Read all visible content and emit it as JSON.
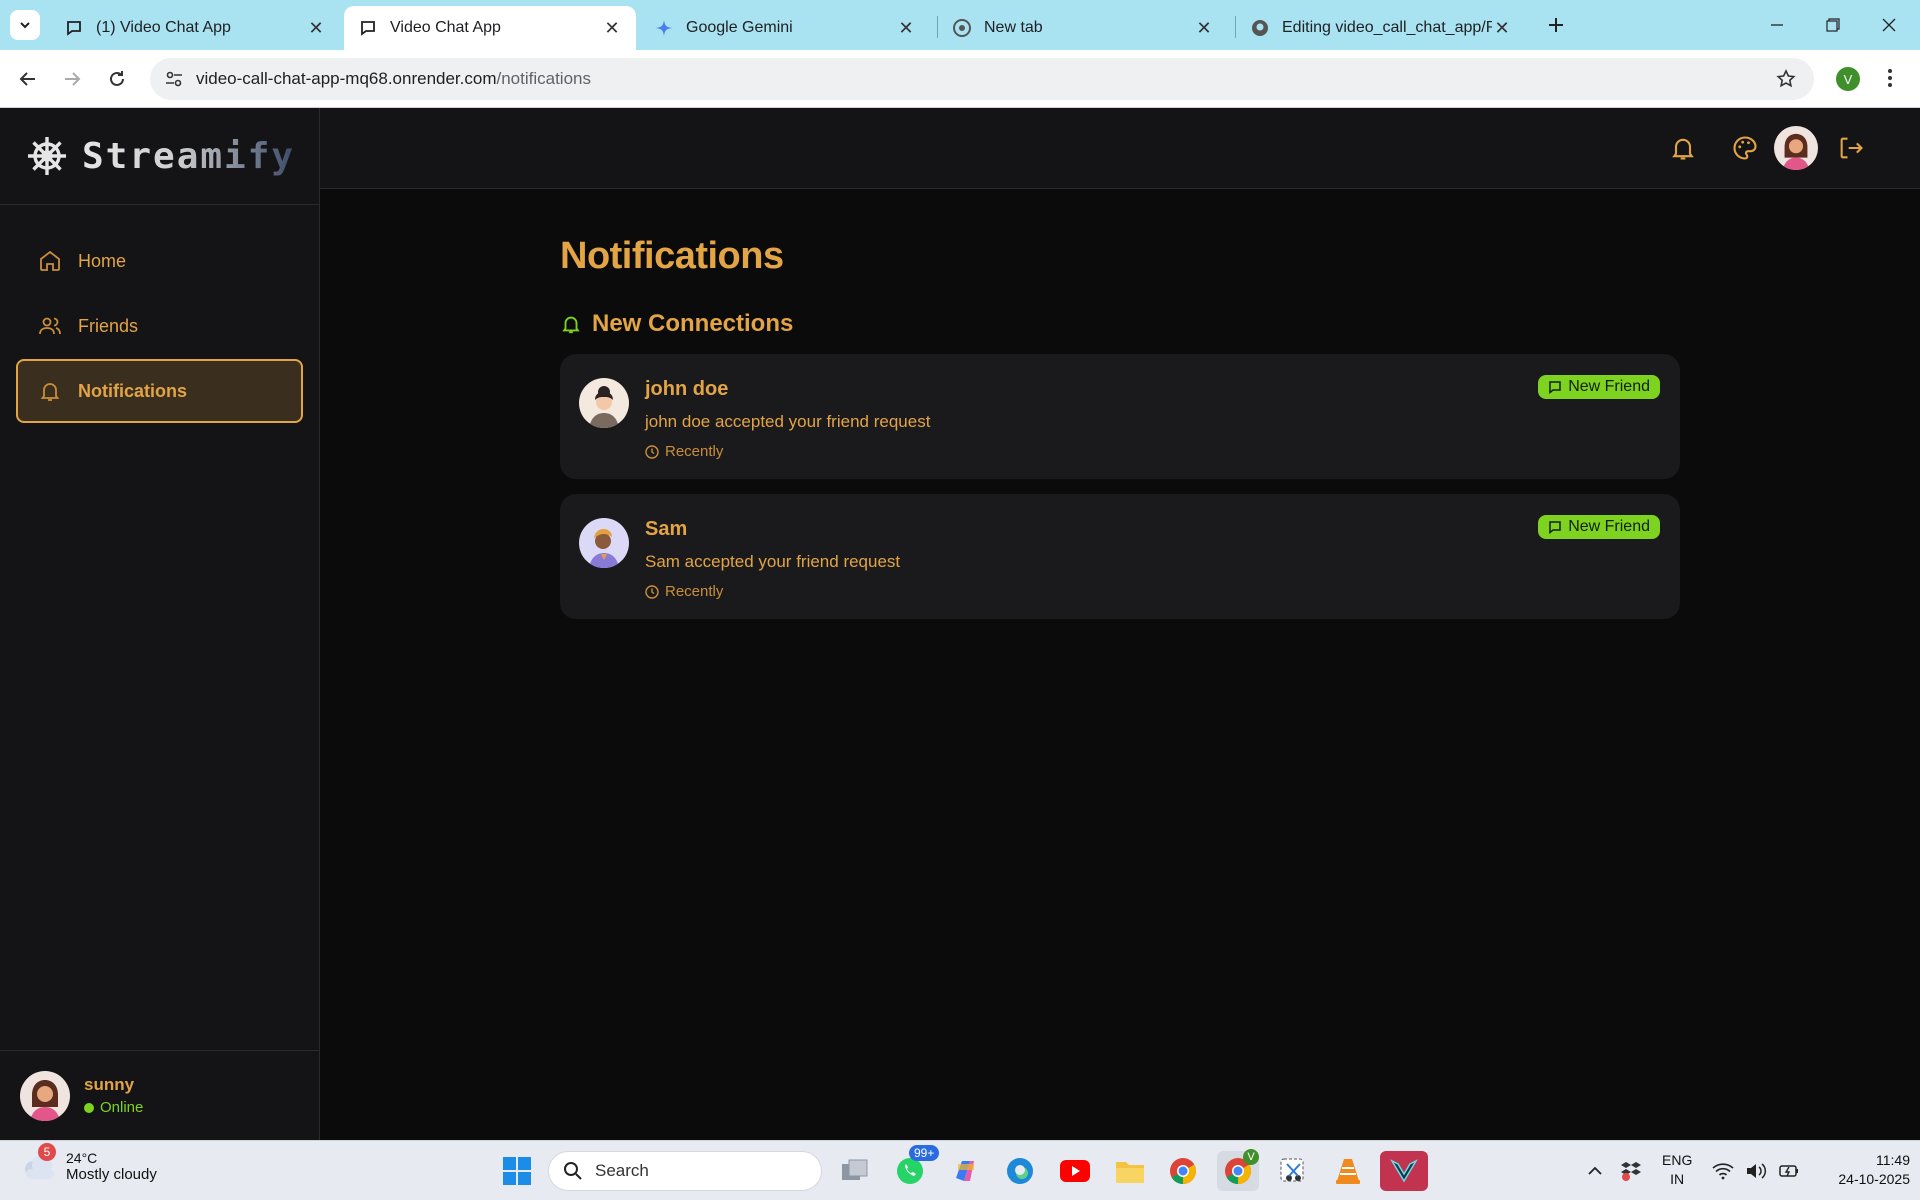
{
  "browser": {
    "tabs": [
      {
        "title": "(1) Video Chat App",
        "active": false,
        "icon": "chat-icon"
      },
      {
        "title": "Video Chat App",
        "active": true,
        "icon": "chat-icon"
      },
      {
        "title": "Google Gemini",
        "active": false,
        "icon": "gemini-icon"
      },
      {
        "title": "New tab",
        "active": false,
        "icon": "chrome-icon"
      },
      {
        "title": "Editing video_call_chat_app/RE/",
        "active": false,
        "icon": "github-icon"
      }
    ],
    "url_host": "video-call-chat-app-mq68.onrender.com",
    "url_path": "/notifications",
    "profile_initial": "V"
  },
  "app": {
    "brand": "Streamify",
    "nav": [
      {
        "label": "Home",
        "icon": "home-icon",
        "active": false
      },
      {
        "label": "Friends",
        "icon": "users-icon",
        "active": false
      },
      {
        "label": "Notifications",
        "icon": "bell-icon",
        "active": true
      }
    ],
    "user": {
      "name": "sunny",
      "status": "Online"
    },
    "page_title": "Notifications",
    "section_title": "New Connections",
    "notifications": [
      {
        "name": "john doe",
        "message": "john doe accepted your friend request",
        "time": "Recently",
        "badge": "New Friend"
      },
      {
        "name": "Sam",
        "message": "Sam accepted your friend request",
        "time": "Recently",
        "badge": "New Friend"
      }
    ],
    "colors": {
      "accent": "#e2a445",
      "badge": "#7ed321",
      "bg": "#0b0b0c",
      "panel": "#141416"
    }
  },
  "taskbar": {
    "weather_badge": "5",
    "temperature": "24°C",
    "weather": "Mostly cloudy",
    "search_placeholder": "Search",
    "whatsapp_badge": "99+",
    "chrome_badge": "V",
    "lang_top": "ENG",
    "lang_bottom": "IN",
    "time": "11:49",
    "date": "24-10-2025"
  }
}
